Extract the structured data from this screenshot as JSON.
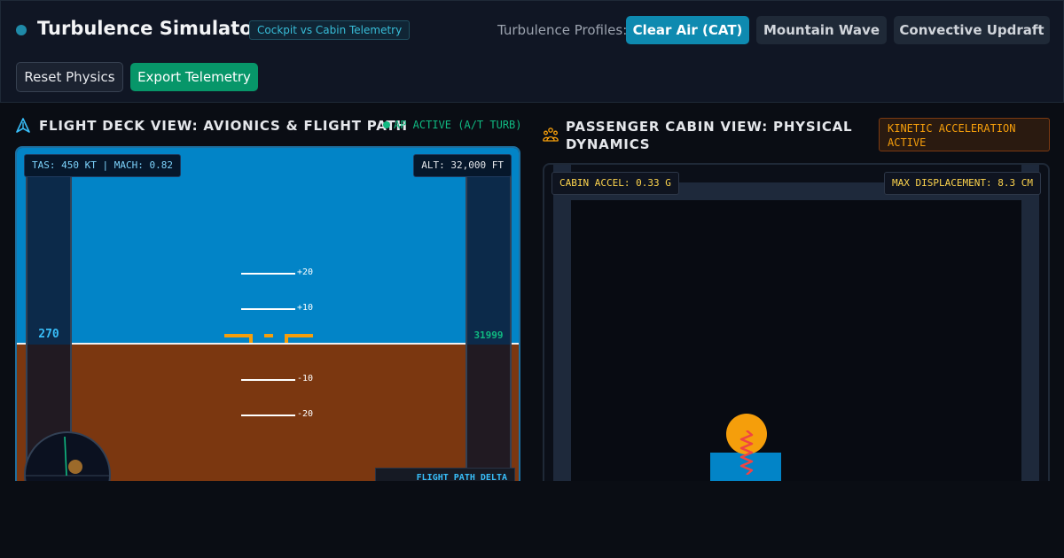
{
  "header": {
    "title": "Turbulence Simulator",
    "subtitle_badge": "Cockpit vs Cabin Telemetry",
    "profiles_label": "Turbulence Profiles:",
    "profiles": [
      "Clear Air (CAT)",
      "Mountain Wave",
      "Convective Updraft"
    ],
    "active_profile": "Clear Air (CAT)",
    "reset_label": "Reset Physics",
    "export_label": "Export Telemetry"
  },
  "flight_deck": {
    "title": "FLIGHT DECK VIEW: AVIONICS & FLIGHT PATH",
    "ap_status": "AP ACTIVE (A/T TURB)",
    "tas_readout": "TAS: 450 KT | MACH: 0.82",
    "alt_readout": "ALT: 32,000 FT",
    "speed_value": "270",
    "altitude_value": "31999",
    "pitch_labels": [
      "+20",
      "+10",
      "-10",
      "-20"
    ],
    "flight_path_label": "FLIGHT PATH DELTA"
  },
  "cabin": {
    "title": "PASSENGER CABIN VIEW: PHYSICAL DYNAMICS",
    "kinetic_badge": "KINETIC ACCELERATION ACTIVE",
    "accel_readout": "CABIN ACCEL: 0.33 G",
    "displacement_readout": "MAX DISPLACEMENT: 8.3 CM"
  },
  "colors": {
    "accent": "#0e8ab0",
    "success": "#079669",
    "warning": "#f59e0b",
    "sky": "#0284c7",
    "ground": "#7b3710"
  }
}
